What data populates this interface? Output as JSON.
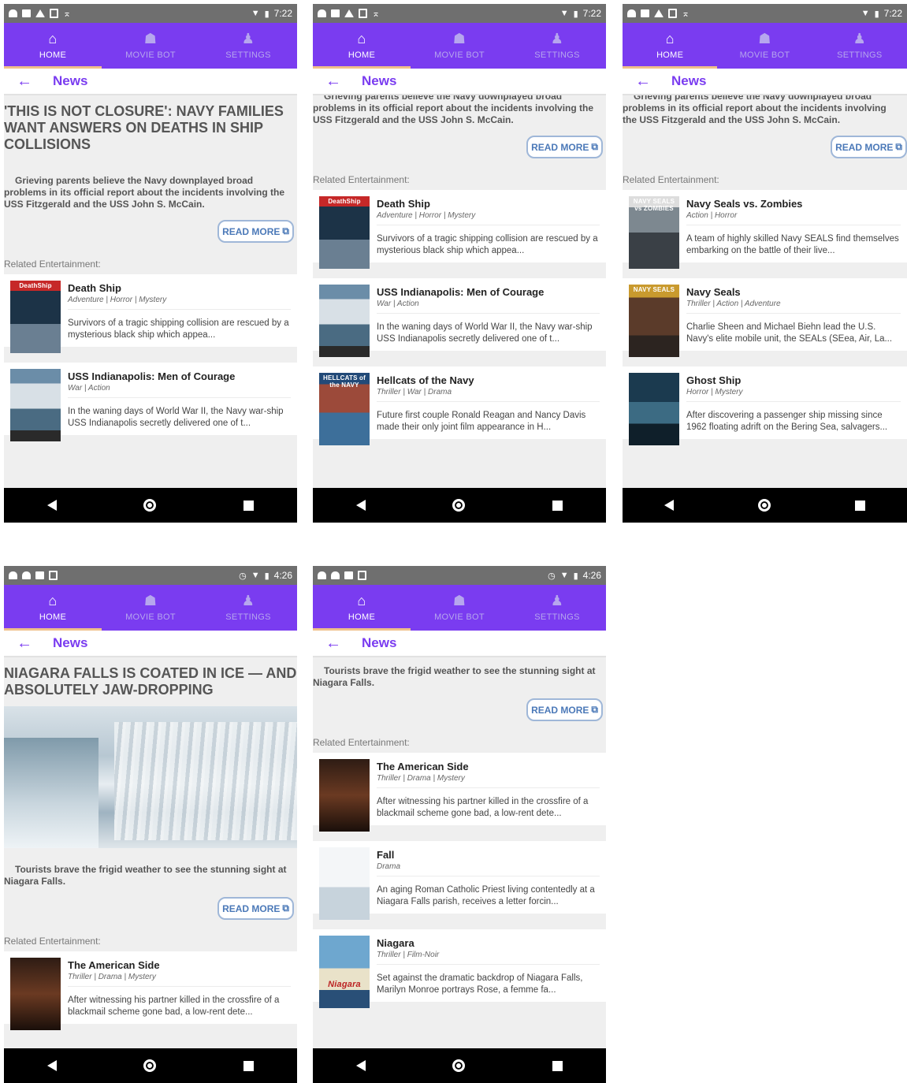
{
  "tabs": [
    {
      "label": "HOME",
      "icon": "home-icon"
    },
    {
      "label": "MOVIE BOT",
      "icon": "robot-icon"
    },
    {
      "label": "SETTINGS",
      "icon": "person-icon"
    }
  ],
  "news_label": "News",
  "read_more_label": "READ MORE",
  "related_label": "Related Entertainment:",
  "status": {
    "time_a": "7:22",
    "time_b": "4:26"
  },
  "articles": {
    "navy": {
      "headline": "'THIS IS NOT CLOSURE': NAVY FAMILIES WANT ANSWERS ON DEATHS IN SHIP COLLISIONS",
      "summary": "Grieving parents believe the Navy downplayed broad problems in its official report about the incidents involving the USS Fitzgerald and the USS John S. McCain.",
      "summary_top": "Grieving parents believe the Navy downplayed broad"
    },
    "niagara": {
      "headline": "NIAGARA FALLS IS COATED IN ICE — AND ABSOLUTELY JAW-DROPPING",
      "summary": "Tourists brave the frigid weather to see the stunning sight at Niagara Falls."
    }
  },
  "movies": {
    "death_ship": {
      "title": "Death Ship",
      "genre": "Adventure | Horror | Mystery",
      "desc": "Survivors of a tragic shipping collision are rescued by a mysterious black ship which appea...",
      "poster_text": "DeathShip"
    },
    "uss_indy": {
      "title": "USS Indianapolis: Men of Courage",
      "genre": "War | Action",
      "desc": "In the waning days of World War II, the Navy war-ship USS Indianapolis secretly delivered one of t..."
    },
    "hellcats": {
      "title": "Hellcats of the Navy",
      "genre": "Thriller | War | Drama",
      "desc": "Future  first couple  Ronald Reagan and Nancy Davis made their only joint film appearance in H...",
      "poster_text": "HELLCATS of the NAVY"
    },
    "seals_zombies": {
      "title": "Navy Seals vs. Zombies",
      "genre": "Action | Horror",
      "desc": "A team of highly skilled Navy SEALS find themselves embarking on the battle of their live...",
      "poster_text": "NAVY SEALS vs ZOMBIES"
    },
    "navy_seals": {
      "title": "Navy Seals",
      "genre": "Thriller | Action | Adventure",
      "desc": "Charlie Sheen and Michael Biehn lead the U.S. Navy's elite mobile unit, the SEALs (SEea, Air, La...",
      "poster_text": "NAVY SEALS"
    },
    "ghost_ship": {
      "title": "Ghost Ship",
      "genre": "Horror | Mystery",
      "desc": "After discovering a passenger ship missing since 1962 floating adrift on the Bering Sea, salvagers..."
    },
    "american_side": {
      "title": "The American Side",
      "genre": "Thriller | Drama | Mystery",
      "desc": "After witnessing his partner killed in the crossfire of a blackmail scheme gone bad, a low-rent dete..."
    },
    "fall": {
      "title": "Fall",
      "genre": "Drama",
      "desc": "An aging Roman Catholic Priest living contentedly at a Niagara Falls parish, receives a letter forcin..."
    },
    "niagara": {
      "title": "Niagara",
      "genre": "Thriller | Film-Noir",
      "desc": "Set against the dramatic backdrop of Niagara Falls, Marilyn Monroe portrays Rose, a femme fa...",
      "poster_text": "Niagara"
    }
  },
  "colors": {
    "accent": "#7a3cf0",
    "readmore": "#4b79b8",
    "statusbar": "#6f6f6f"
  }
}
